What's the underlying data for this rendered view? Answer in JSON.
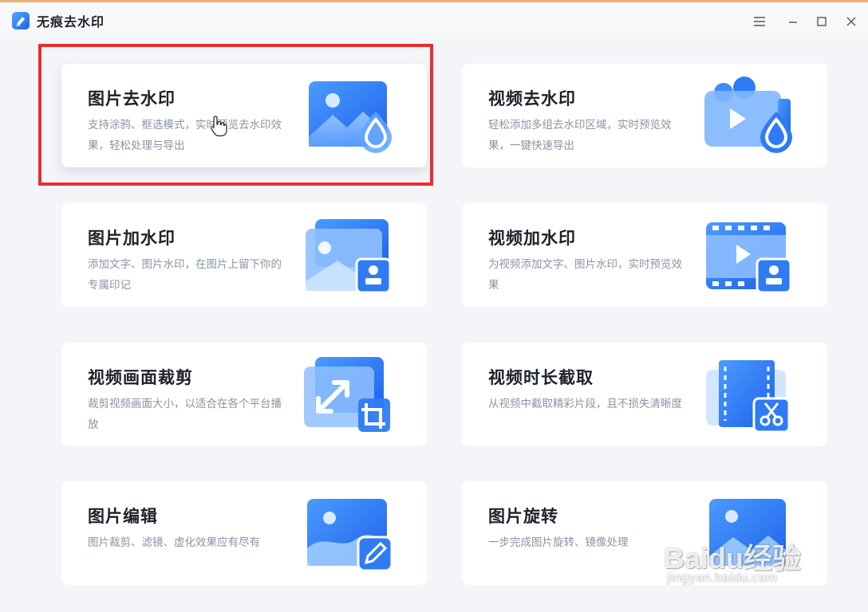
{
  "window": {
    "title": "无痕去水印",
    "controls": [
      "menu-icon",
      "minimize-icon",
      "maximize-icon",
      "close-icon"
    ]
  },
  "cards": [
    {
      "title": "图片去水印",
      "desc": "支持涂鸦、框选模式，实时预览去水印效果，轻松处理与导出",
      "icon": "image-droplet-icon",
      "selected": true
    },
    {
      "title": "视频去水印",
      "desc": "轻松添加多组去水印区域，实时预览效果，一键快速导出",
      "icon": "video-droplet-icon",
      "selected": false
    },
    {
      "title": "图片加水印",
      "desc": "添加文字、图片水印，在图片上留下你的专属印记",
      "icon": "image-stamp-icon",
      "selected": false
    },
    {
      "title": "视频加水印",
      "desc": "为视频添加文字、图片水印，实时预览效果",
      "icon": "video-stamp-icon",
      "selected": false
    },
    {
      "title": "视频画面裁剪",
      "desc": "裁剪视频画面大小，以适合在各个平台播放",
      "icon": "resize-crop-icon",
      "selected": false
    },
    {
      "title": "视频时长截取",
      "desc": "从视频中截取精彩片段，且不损失清晰度",
      "icon": "film-scissors-icon",
      "selected": false
    },
    {
      "title": "图片编辑",
      "desc": "图片裁剪、滤镜、虚化效果应有尽有",
      "icon": "image-edit-icon",
      "selected": false
    },
    {
      "title": "图片旋转",
      "desc": "一步完成图片旋转、镜像处理",
      "icon": "image-rotate-icon",
      "selected": false
    }
  ],
  "watermark": {
    "logo": "Baidu经验",
    "url": "jingyan.baidu.com"
  },
  "colors": {
    "accent": "#2f7bf5",
    "highlight_border": "#ea2d30",
    "card_bg": "#ffffff",
    "page_bg": "#f4f5f8"
  }
}
